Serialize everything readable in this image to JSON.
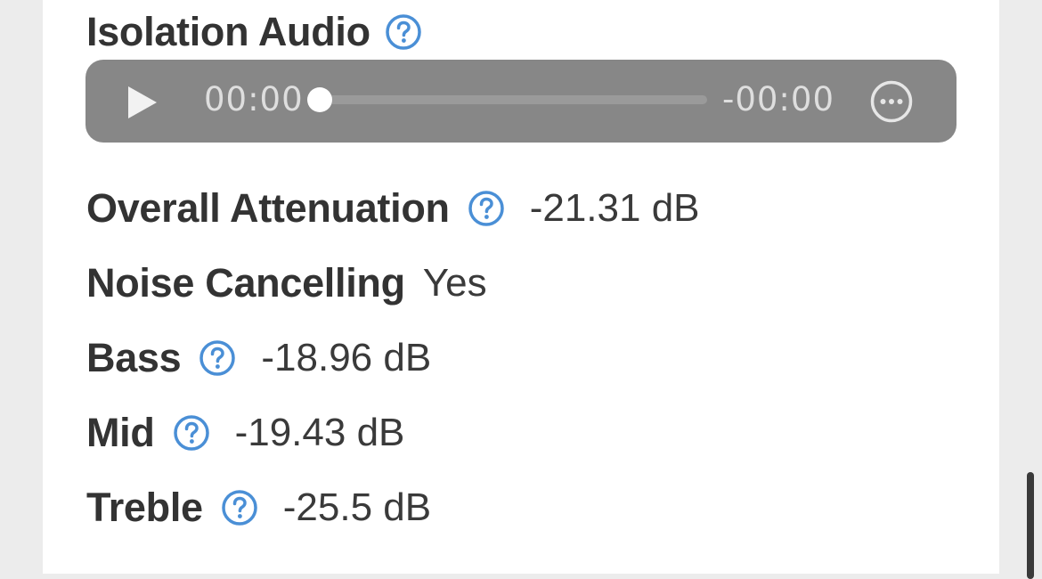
{
  "section": {
    "title": "Isolation Audio"
  },
  "player": {
    "current_time": "00:00",
    "remaining_time": "-00:00",
    "progress_fraction": 0
  },
  "stats": [
    {
      "label": "Overall Attenuation",
      "value": "-21.31 dB",
      "has_help": true
    },
    {
      "label": "Noise Cancelling",
      "value": "Yes",
      "has_help": false
    },
    {
      "label": "Bass",
      "value": "-18.96 dB",
      "has_help": true
    },
    {
      "label": "Mid",
      "value": "-19.43 dB",
      "has_help": true
    },
    {
      "label": "Treble",
      "value": "-25.5 dB",
      "has_help": true
    }
  ],
  "colors": {
    "help_icon": "#4a8fd6",
    "player_bg": "#878787",
    "text": "#333333"
  },
  "icons": {
    "help": "question-circle-icon",
    "play": "play-icon",
    "more": "more-options-icon"
  }
}
